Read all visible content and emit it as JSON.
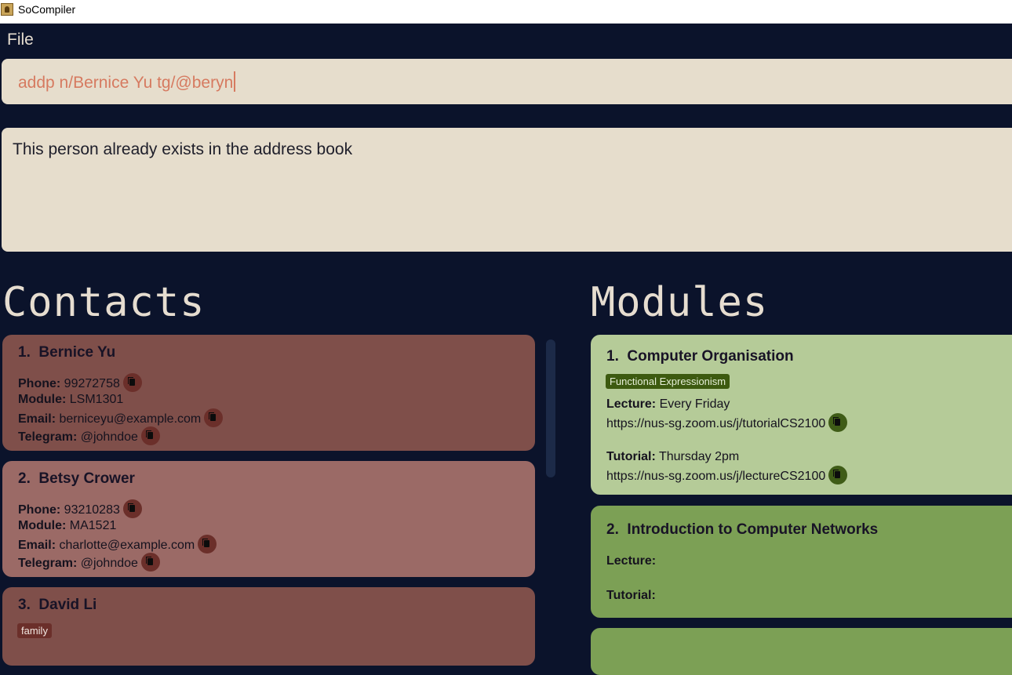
{
  "window": {
    "title": "SoCompiler"
  },
  "menu": {
    "file_label": "File"
  },
  "command": {
    "value": "addp n/Bernice Yu tg/@beryn"
  },
  "result": {
    "message": "This person already exists in the address book"
  },
  "contacts": {
    "heading": "Contacts",
    "items": [
      {
        "index": "1.",
        "name": "Bernice Yu",
        "phone_label": "Phone:",
        "phone": "99272758",
        "module_label": "Module:",
        "module": "LSM1301",
        "email_label": "Email:",
        "email": "berniceyu@example.com",
        "telegram_label": "Telegram:",
        "telegram": "@johndoe"
      },
      {
        "index": "2.",
        "name": "Betsy Crower",
        "phone_label": "Phone:",
        "phone": "93210283",
        "module_label": "Module:",
        "module": "MA1521",
        "email_label": "Email:",
        "email": "charlotte@example.com",
        "telegram_label": "Telegram:",
        "telegram": "@johndoe"
      },
      {
        "index": "3.",
        "name": "David Li",
        "tag": "family"
      }
    ]
  },
  "modules": {
    "heading": "Modules",
    "items": [
      {
        "index": "1.",
        "name": "Computer Organisation",
        "tag": "Functional Expressionism",
        "lecture_label": "Lecture:",
        "lecture": "Every Friday",
        "lecture_link": "https://nus-sg.zoom.us/j/tutorialCS2100",
        "tutorial_label": "Tutorial:",
        "tutorial": "Thursday 2pm",
        "tutorial_link": "https://nus-sg.zoom.us/j/lectureCS2100"
      },
      {
        "index": "2.",
        "name": "Introduction to Computer Networks",
        "lecture_label": "Lecture:",
        "tutorial_label": "Tutorial:"
      }
    ]
  },
  "colors": {
    "background": "#0b132b",
    "input_bg": "#e6ddcc",
    "command_text": "#d67a60",
    "contact_card_dark": "#7f4f4a",
    "contact_card_light": "#9b6a66",
    "module_card_light": "#b5cb98",
    "module_card_dark": "#7ca055"
  },
  "icons": {
    "copy": "copy-icon",
    "app": "app-icon"
  }
}
